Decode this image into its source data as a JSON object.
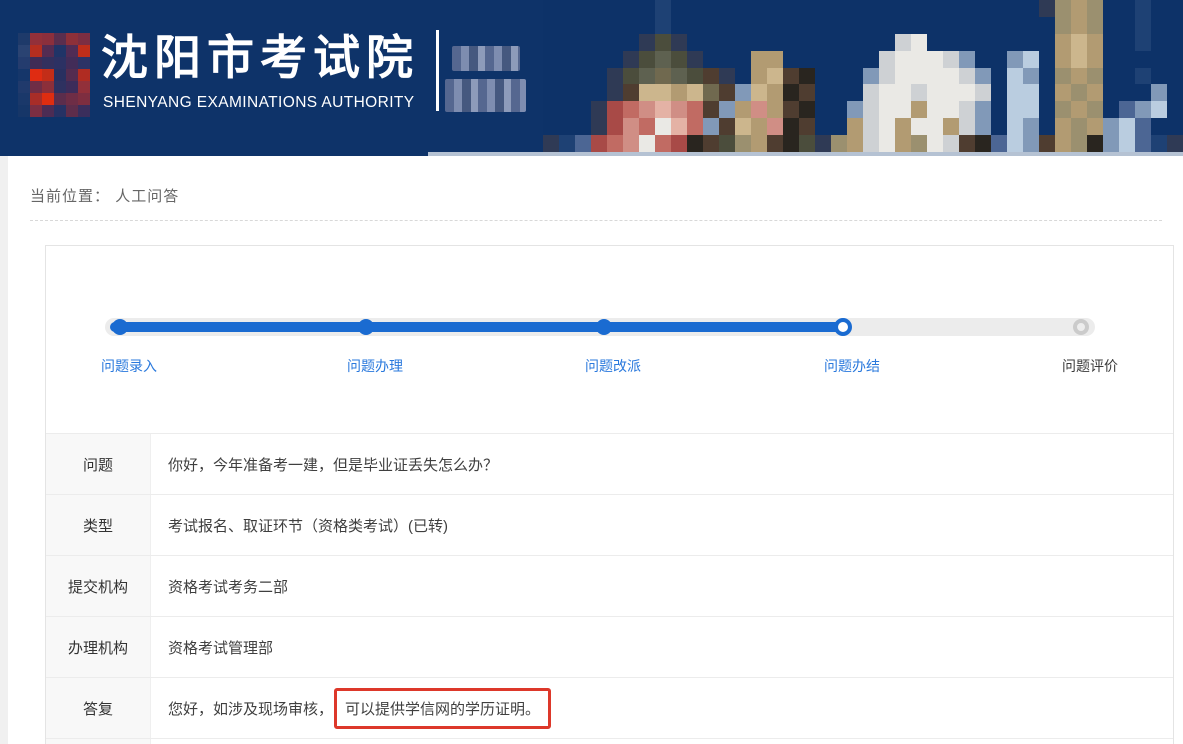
{
  "colors": {
    "header_bg": "#0e3369",
    "accent_blue": "#1a6bd1",
    "label_active_blue": "#2a79dd",
    "track_gray": "#ececec",
    "label_column_bg": "#f8f8f8",
    "highlight_red": "#dd382a"
  },
  "header": {
    "org_name_cn": "沈阳市考试院",
    "org_name_en": "SHENYANG EXAMINATIONS AUTHORITY",
    "logo_mosaic": {
      "rows": [
        [
          "#1e3a6a",
          "#93303a",
          "#8c2f3c",
          "#5a2e4e",
          "#8d3039",
          "#7c2e42"
        ],
        [
          "#2a4372",
          "#b52e20",
          "#542c52",
          "#203467",
          "#502c55",
          "#bf2e1a"
        ],
        [
          "#243c6e",
          "#3f2c56",
          "#32305e",
          "#2c3163",
          "#422c58",
          "#2c3366"
        ],
        [
          "#15366a",
          "#df2c12",
          "#c32d18",
          "#293060",
          "#532c50",
          "#b02c22"
        ],
        [
          "#203a6c",
          "#6f2d46",
          "#8c2f3a",
          "#2e3160",
          "#3c2c5a",
          "#92303a"
        ],
        [
          "#1a386a",
          "#a82d28",
          "#df2d10",
          "#5c2d4c",
          "#6e2d46",
          "#7e2e40"
        ],
        [
          "#163668",
          "#7c2e42",
          "#4c2c54",
          "#263264",
          "#5e2d4b",
          "#3a2e5c"
        ]
      ]
    },
    "photo_mosaic": {
      "palette": {
        "B": "#0d3268",
        "b": "#1e4174",
        "D": "#2f3a55",
        "g": "#4b4d3c",
        "G": "#5e6150",
        "o": "#70694f",
        "t": "#b29b72",
        "T": "#ccb68d",
        "m": "#9b906f",
        "d": "#4f3d30",
        "k": "#29251f",
        "r": "#a84a47",
        "R": "#c16b63",
        "p": "#d08e85",
        "P": "#e4b2a5",
        "w": "#eae9e5",
        "W": "#ced1d4",
        "s": "#8199b8",
        "c": "#bacde0",
        "S": "#4c6694"
      },
      "rows": [
        "BBBBBBBbBBBBBBBBBBBBBBBBBBBBBBBDmtmBBbBB",
        "BBBBBBBbBBBBBBBBBBBBBBBBBBBBBBBBmtmBBbBB",
        "BBBBBBDgDBBBBBBBBBBBBBWwBBBBBBBBtTtBBbBB",
        "BBBBBDgGgDBBBttBBBBBBWwwwWsBBscBtTtBBBBB",
        "BBBBDgGoGgdDBtTdkBBBsWwwwwWsBcsBmtmBBbBB",
        "BBBBDdTTtTodsTtkdBBBWwwWwwwWBccBtmtBBBsB",
        "BBBDrRpPpRdstptdkBBsWwwtwwWsBccBmtmBSscB",
        "BBBDrpRwPRsdTtpkdBBtWwtwwtWsBcsBtmtscSBB",
        "DbSrRpwRrkdgmtdkgDmtWwtmwWdkScsdtmkscSbD"
      ]
    }
  },
  "breadcrumb": {
    "label": "当前位置：",
    "current": "人工问答"
  },
  "stepper": {
    "steps": [
      {
        "label": "问题录入",
        "state": "done"
      },
      {
        "label": "问题办理",
        "state": "done"
      },
      {
        "label": "问题改派",
        "state": "done"
      },
      {
        "label": "问题办结",
        "state": "current"
      },
      {
        "label": "问题评价",
        "state": "pending"
      }
    ]
  },
  "details": {
    "rows": [
      {
        "label": "问题",
        "value": "你好，今年准备考一建，但是毕业证丢失怎么办？"
      },
      {
        "label": "类型",
        "value": "考试报名、取证环节（资格类考试）(已转)"
      },
      {
        "label": "提交机构",
        "value": "资格考试考务二部"
      },
      {
        "label": "办理机构",
        "value": "资格考试管理部"
      },
      {
        "label": "答复",
        "value_prefix": "您好，如涉及现场审核，",
        "value_highlight": "可以提供学信网的学历证明。"
      }
    ]
  }
}
